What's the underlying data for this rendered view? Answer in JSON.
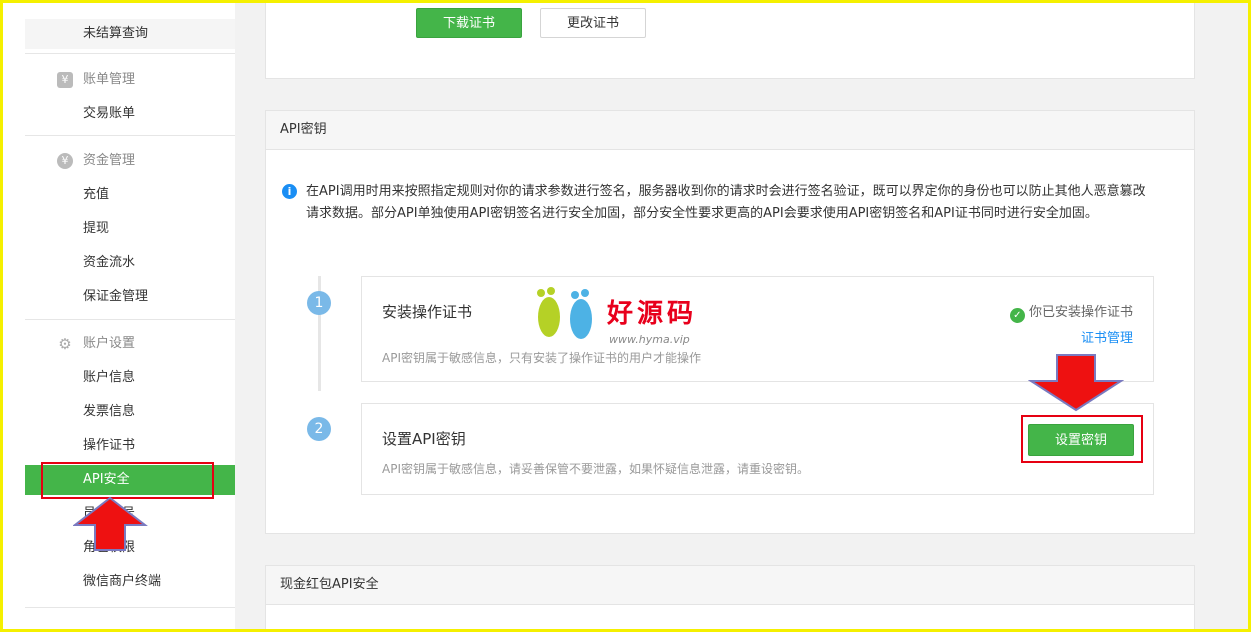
{
  "sidebar": {
    "items": [
      {
        "label": "未结算查询"
      },
      {
        "group": "账单管理",
        "icon": "yen-icon"
      },
      {
        "label": "交易账单"
      },
      {
        "group": "资金管理",
        "icon": "money-bag-icon"
      },
      {
        "label": "充值"
      },
      {
        "label": "提现"
      },
      {
        "label": "资金流水"
      },
      {
        "label": "保证金管理"
      },
      {
        "group": "账户设置",
        "icon": "gear-icon"
      },
      {
        "label": "账户信息"
      },
      {
        "label": "发票信息"
      },
      {
        "label": "操作证书"
      },
      {
        "label": "API安全"
      },
      {
        "label": "员工账号"
      },
      {
        "label": "角色权限"
      },
      {
        "label": "微信商户终端"
      }
    ]
  },
  "cert_panel": {
    "download_label": "下载证书",
    "change_label": "更改证书"
  },
  "api_panel": {
    "title": "API密钥",
    "info": "在API调用时用来按照指定规则对你的请求参数进行签名，服务器收到你的请求时会进行签名验证，既可以界定你的身份也可以防止其他人恶意篡改请求数据。部分API单独使用API密钥签名进行安全加固，部分安全性要求更高的API会要求使用API密钥签名和API证书同时进行安全加固。",
    "steps": [
      {
        "num": "1",
        "title": "安装操作证书",
        "desc": "API密钥属于敏感信息，只有安装了操作证书的用户才能操作",
        "status": "你已安装操作证书",
        "link": "证书管理"
      },
      {
        "num": "2",
        "title": "设置API密钥",
        "desc": "API密钥属于敏感信息，请妥善保管不要泄露，如果怀疑信息泄露，请重设密钥。",
        "button": "设置密钥"
      }
    ]
  },
  "redpacket_panel": {
    "title": "现金红包API安全"
  },
  "watermark": {
    "text": "好源码",
    "url": "www.hyma.vip"
  },
  "colors": {
    "green": "#44b549",
    "red": "#e60012",
    "blue": "#1a8ef4"
  }
}
